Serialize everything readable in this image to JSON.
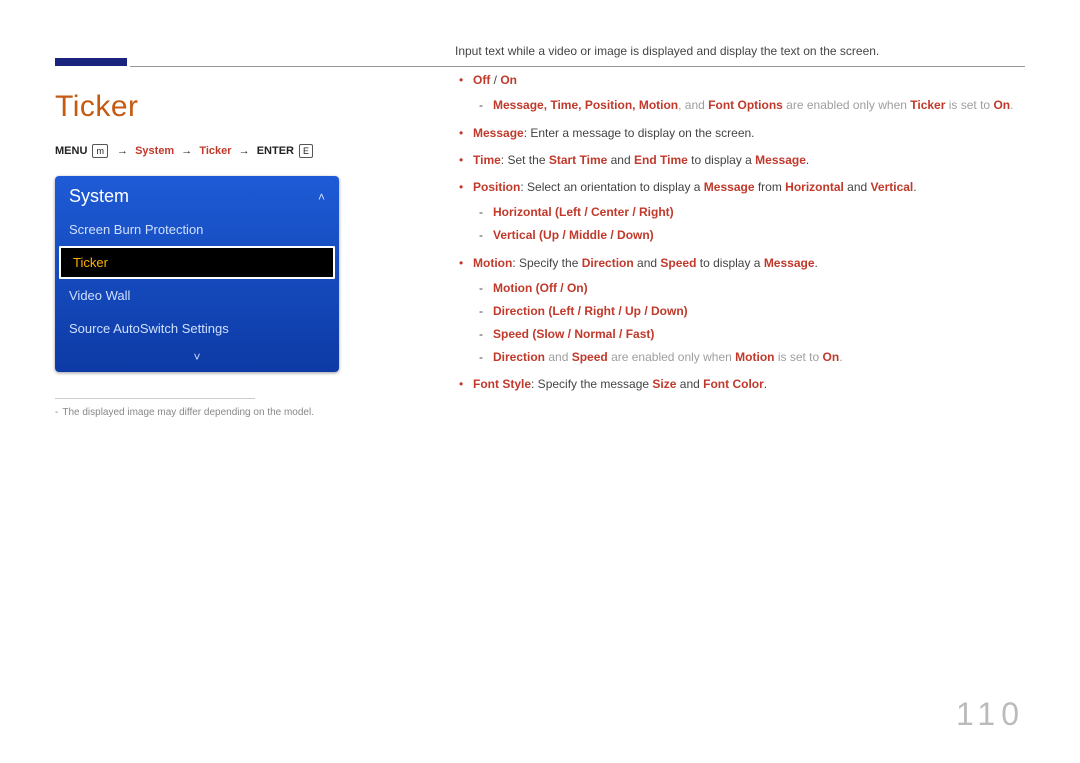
{
  "page_number": "110",
  "title": "Ticker",
  "nav": {
    "menu": "MENU",
    "system": "System",
    "ticker": "Ticker",
    "enter": "ENTER",
    "menu_icon": "m",
    "enter_icon": "E"
  },
  "osd": {
    "header": "System",
    "items": [
      "Screen Burn Protection",
      "Ticker",
      "Video Wall",
      "Source AutoSwitch Settings"
    ],
    "selected_index": 1
  },
  "note": "The displayed image may differ depending on the model.",
  "intro": "Input text while a video or image is displayed and display the text on the screen.",
  "b1": {
    "off": "Off",
    "slash": " / ",
    "on": "On"
  },
  "b1_sub": {
    "prefix_items": "Message, Time, Position, Motion",
    "and": ", and ",
    "font_options": "Font Options",
    "mid": " are enabled only when ",
    "ticker": "Ticker",
    "mid2": " is set to ",
    "on": "On",
    "dot": "."
  },
  "b2": {
    "label": "Message",
    "text": ": Enter a message to display on the screen."
  },
  "b3": {
    "label": "Time",
    "set": ": Set the ",
    "start": "Start Time",
    "and": " and ",
    "end": "End Time",
    "mid": " to display a ",
    "msg": "Message",
    "dot": "."
  },
  "b4": {
    "label": "Position",
    "text1": ": Select an orientation to display a ",
    "msg": "Message",
    "from": " from ",
    "horiz": "Horizontal",
    "and": " and ",
    "vert": "Vertical",
    "dot": ".",
    "sub1": "Horizontal (Left / Center / Right)",
    "sub2": "Vertical (Up / Middle / Down)"
  },
  "b5": {
    "label": "Motion",
    "text1": ": Specify the ",
    "dir": "Direction",
    "and": " and ",
    "speed": "Speed",
    "mid": " to display a ",
    "msg": "Message",
    "dot": ".",
    "sub1": "Motion (Off / On)",
    "sub2": "Direction (Left / Right / Up / Down)",
    "sub3": "Speed (Slow / Normal / Fast)",
    "subnote_dir": "Direction",
    "subnote_and": " and ",
    "subnote_speed": "Speed",
    "subnote_mid": " are enabled only when ",
    "subnote_motion": "Motion",
    "subnote_set": " is set to ",
    "subnote_on": "On",
    "subnote_dot": "."
  },
  "b6": {
    "label": "Font Style",
    "text1": ": Specify the message ",
    "size": "Size",
    "and": " and ",
    "fc": "Font Color",
    "dot": "."
  }
}
